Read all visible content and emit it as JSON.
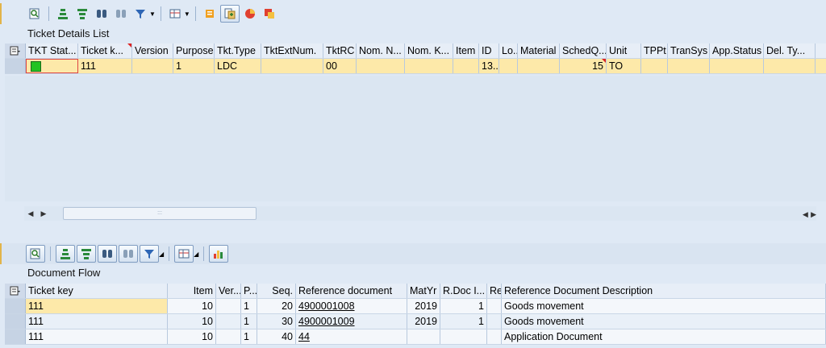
{
  "top": {
    "title": "Ticket Details List",
    "columns": [
      "TKT Stat...",
      "Ticket k...",
      "Version",
      "Purpose",
      "Tkt.Type",
      "TktExtNum.",
      "TktRC",
      "Nom. N...",
      "Nom. K...",
      "Item",
      "ID",
      "Lo...",
      "Material",
      "SchedQ...",
      "Unit",
      "TPPt",
      "TranSys",
      "App.Status",
      "Del. Ty..."
    ],
    "row": [
      "",
      "111",
      "",
      "1",
      "LDC",
      "",
      "00",
      "",
      "",
      "",
      "13...",
      "",
      "",
      "15",
      "TO",
      "",
      "",
      "",
      ""
    ],
    "scroll_marker": ":::"
  },
  "bottom": {
    "title": "Document Flow",
    "columns": [
      "Ticket key",
      "Item",
      "Ver...",
      "P...",
      "Seq.",
      "Reference document",
      "MatYr",
      "R.Doc I...",
      "Re",
      "Reference Document Description"
    ],
    "rows": [
      [
        "111",
        "10",
        "",
        "1",
        "20",
        "4900001008",
        "2019",
        "1",
        "",
        "Goods movement"
      ],
      [
        "111",
        "10",
        "",
        "1",
        "30",
        "4900001009",
        "2019",
        "1",
        "",
        "Goods movement"
      ],
      [
        "111",
        "10",
        "",
        "1",
        "40",
        "44",
        "",
        "",
        "",
        "Application Document"
      ]
    ]
  },
  "colors": {
    "background": "#dfe9f5",
    "highlight": "#fde9a9",
    "status_green": "#22c322"
  }
}
